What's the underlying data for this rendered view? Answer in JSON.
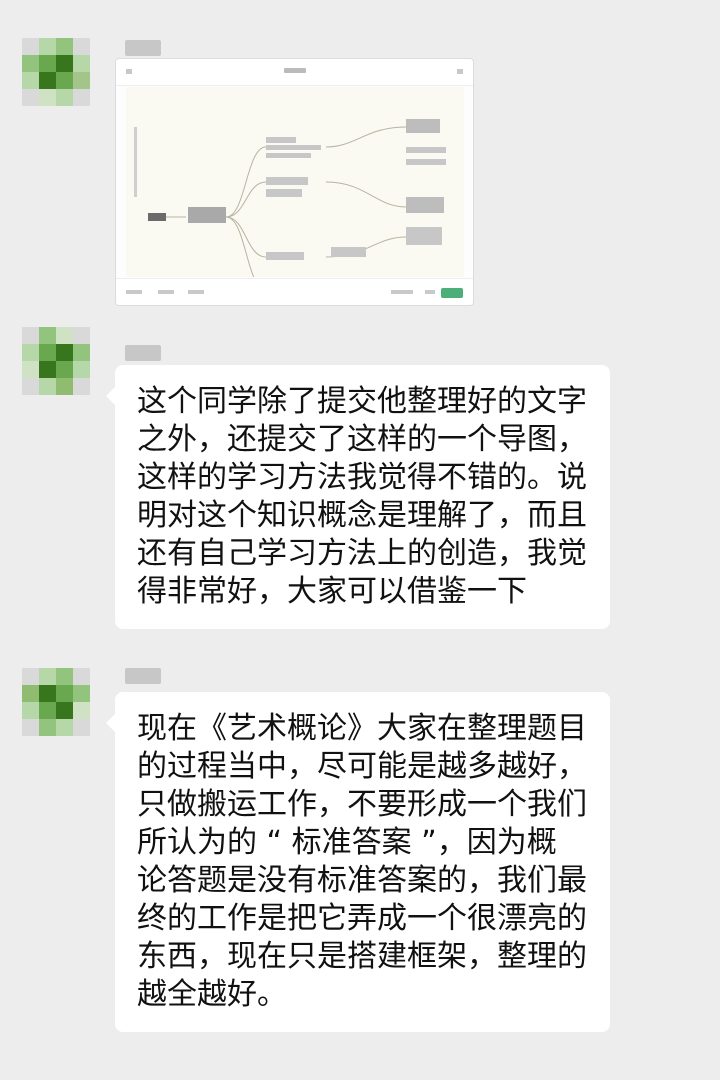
{
  "chat": {
    "messages": [
      {
        "type": "image",
        "sender_name": "",
        "image_description_name": "mind-map-screenshot"
      },
      {
        "type": "text",
        "sender_name": "",
        "lines": [
          "这个同学除了提交他整理好的文字",
          "之外，还提交了这样的一个导图，",
          "这样的学习方法我觉得不错的。说",
          "明对这个知识概念是理解了，而且",
          "还有自己学习方法上的创造，我觉",
          "得非常好，大家可以借鉴一下"
        ]
      },
      {
        "type": "text",
        "sender_name": "",
        "lines": [
          "现在《艺术概论》大家在整理题目",
          "的过程当中，尽可能是越多越好，",
          "只做搬运工作，不要形成一个我们",
          "所认为的 “ 标准答案 ”，因为概",
          "论答题是没有标准答案的，我们最",
          "终的工作是把它弄成一个很漂亮的",
          "东西，现在只是搭建框架，整理的",
          "越全越好。"
        ]
      }
    ]
  },
  "colors": {
    "background": "#ededed",
    "bubble": "#ffffff",
    "text": "#111111",
    "avatar_palette": [
      "#6aa84f",
      "#93c47d",
      "#b6d7a8",
      "#d9d9d9",
      "#38761d",
      "#a3c58a",
      "#cfe2c3",
      "#8fbc6f"
    ]
  }
}
